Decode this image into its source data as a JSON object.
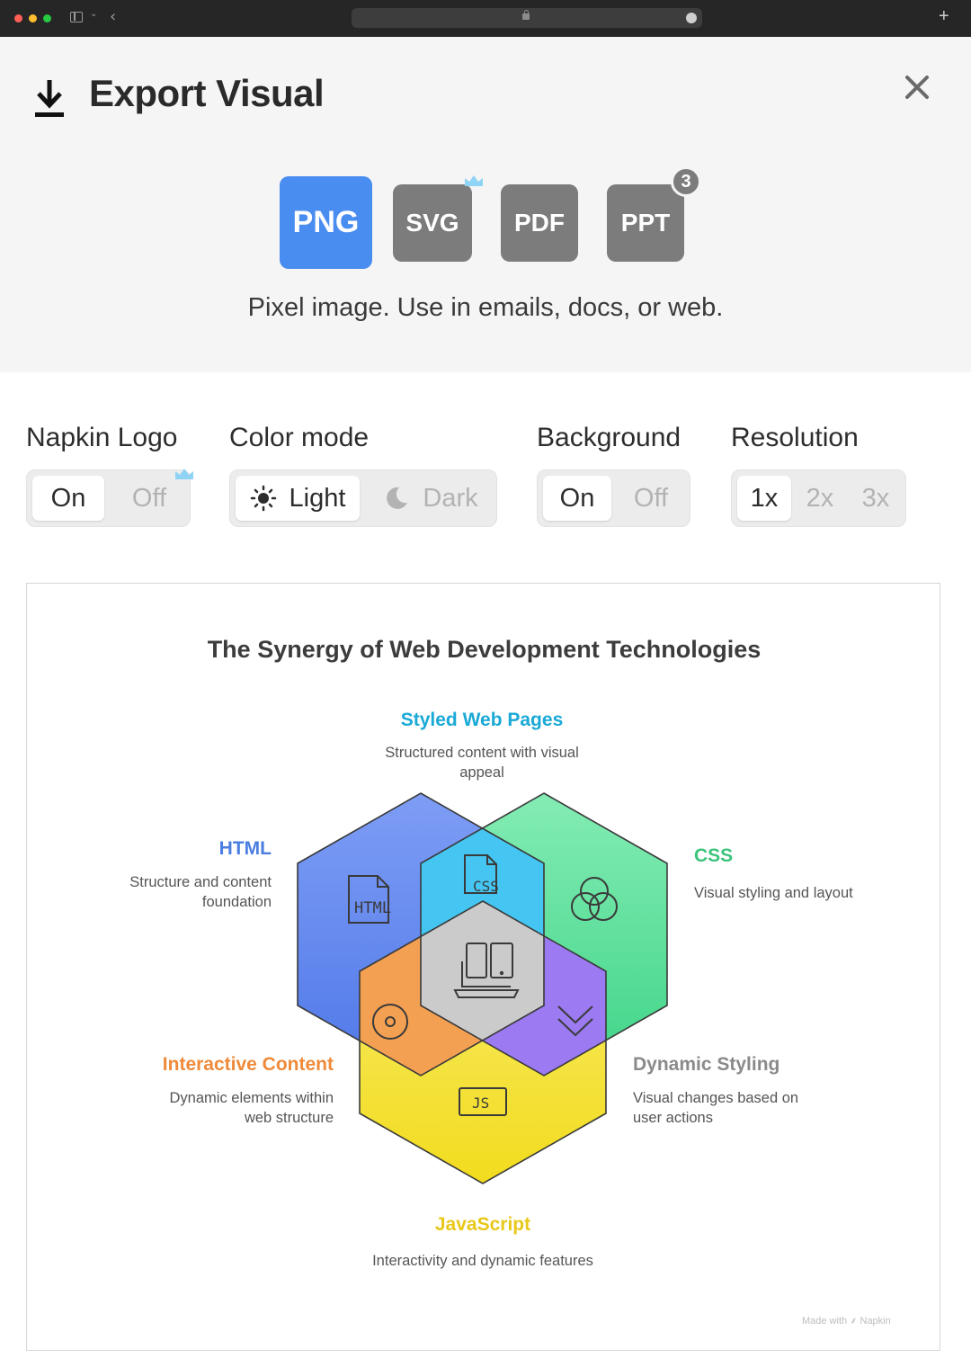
{
  "dialog": {
    "title": "Export Visual",
    "close_icon": "close-icon",
    "download_icon": "download-icon"
  },
  "formats": {
    "items": [
      {
        "label": "PNG",
        "selected": true
      },
      {
        "label": "SVG",
        "premium": true
      },
      {
        "label": "PDF"
      },
      {
        "label": "PPT",
        "badge": "3"
      }
    ],
    "description": "Pixel image. Use in emails, docs, or web."
  },
  "settings": {
    "logo": {
      "label": "Napkin Logo",
      "options": [
        "On",
        "Off"
      ],
      "selected": "On",
      "premium": true
    },
    "color_mode": {
      "label": "Color mode",
      "options": [
        "Light",
        "Dark"
      ],
      "selected": "Light",
      "icons": [
        "sun-icon",
        "moon-icon"
      ]
    },
    "background": {
      "label": "Background",
      "options": [
        "On",
        "Off"
      ],
      "selected": "On"
    },
    "resolution": {
      "label": "Resolution",
      "options": [
        "1x",
        "2x",
        "3x"
      ],
      "selected": "1x"
    }
  },
  "preview": {
    "title": "The Synergy of Web Development Technologies",
    "nodes": {
      "styled": {
        "title": "Styled Web Pages",
        "desc_l1": "Structured content with visual",
        "desc_l2": "appeal",
        "color": "#1aa9d6"
      },
      "html": {
        "title": "HTML",
        "desc_l1": "Structure and content",
        "desc_l2": "foundation",
        "color": "#4a7ee0"
      },
      "css": {
        "title": "CSS",
        "desc_l1": "Visual styling and layout",
        "color": "#3cc47c"
      },
      "interactive": {
        "title": "Interactive Content",
        "desc_l1": "Dynamic elements within",
        "desc_l2": "web structure",
        "color": "#ee8a3a"
      },
      "dynamic": {
        "title": "Dynamic Styling",
        "desc_l1": "Visual changes based on",
        "desc_l2": "user actions",
        "color": "#8a8a8a"
      },
      "javascript": {
        "title": "JavaScript",
        "desc_l1": "Interactivity and dynamic features",
        "color": "#e8c81a"
      }
    },
    "hex_icons": {
      "html": "HTML",
      "css": "CSS",
      "js": "JS"
    },
    "credit": "Made with ⸙ Napkin"
  },
  "colors": {
    "accent": "#4a8df0",
    "format_inactive": "#7c7c7c",
    "premium_crown": "#8fd3f5",
    "hex_blue": "#5f86f0",
    "hex_green": "#5ddf9a",
    "hex_yellow": "#f4e235",
    "overlap_cyan": "#3fc4f2",
    "overlap_orange": "#f4a052",
    "overlap_purple": "#9b78f0",
    "center_gray": "#c9c9c9"
  }
}
